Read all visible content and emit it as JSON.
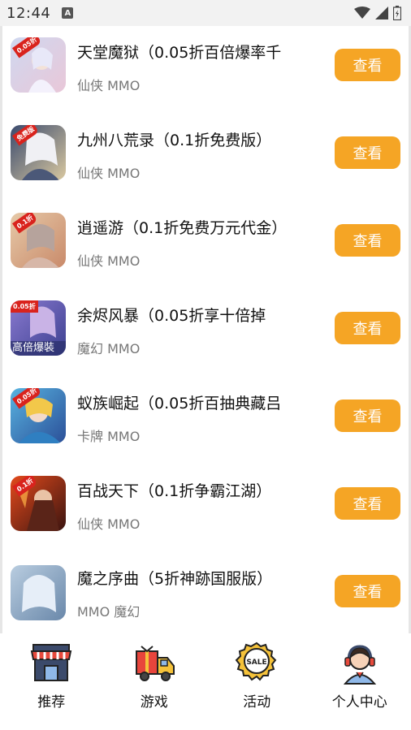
{
  "status": {
    "time": "12:44",
    "notif_letter": "A"
  },
  "button_label": "查看",
  "games": [
    {
      "title": " 天堂魔狱（0.05折百倍爆率千",
      "tags": "仙侠 MMO",
      "badge": "0.05折",
      "bg1": "#cfd8f0",
      "bg2": "#e9c7d8"
    },
    {
      "title": "九州八荒录（0.1折免费版）",
      "tags": "仙侠 MMO",
      "badge": "免费版",
      "bg1": "#3a4a6e",
      "bg2": "#d9c8a0"
    },
    {
      "title": "逍遥游（0.1折免费万元代金）",
      "tags": "仙侠 MMO",
      "badge": "0.1折",
      "bg1": "#e6c9a8",
      "bg2": "#c98a6a"
    },
    {
      "title": "  余烬风暴（0.05折享十倍掉",
      "tags": "魔幻 MMO",
      "badge": "0.05折",
      "bg1": "#8a7ad0",
      "bg2": "#3b3f8f",
      "footer": "高倍爆裝"
    },
    {
      "title": " 蚁族崛起（0.05折百抽典藏吕",
      "tags": "卡牌 MMO",
      "badge": "0.05折",
      "bg1": "#58b3e0",
      "bg2": "#2b4f98"
    },
    {
      "title": "百战天下（0.1折争霸江湖）",
      "tags": "仙侠 MMO",
      "badge": "0.1折",
      "bg1": "#e34a1c",
      "bg2": "#3a1410"
    },
    {
      "title": "魔之序曲（5折神跡国服版）",
      "tags": "MMO 魔幻",
      "badge": "",
      "bg1": "#b9cde0",
      "bg2": "#6a88aa"
    }
  ],
  "nav": [
    {
      "label": "推荐",
      "icon": "store-icon"
    },
    {
      "label": "游戏",
      "icon": "delivery-truck-icon"
    },
    {
      "label": "活动",
      "icon": "sale-badge-icon"
    },
    {
      "label": "个人中心",
      "icon": "customer-service-icon"
    }
  ],
  "colors": {
    "accent": "#f5a525",
    "badge": "#d9231d"
  }
}
